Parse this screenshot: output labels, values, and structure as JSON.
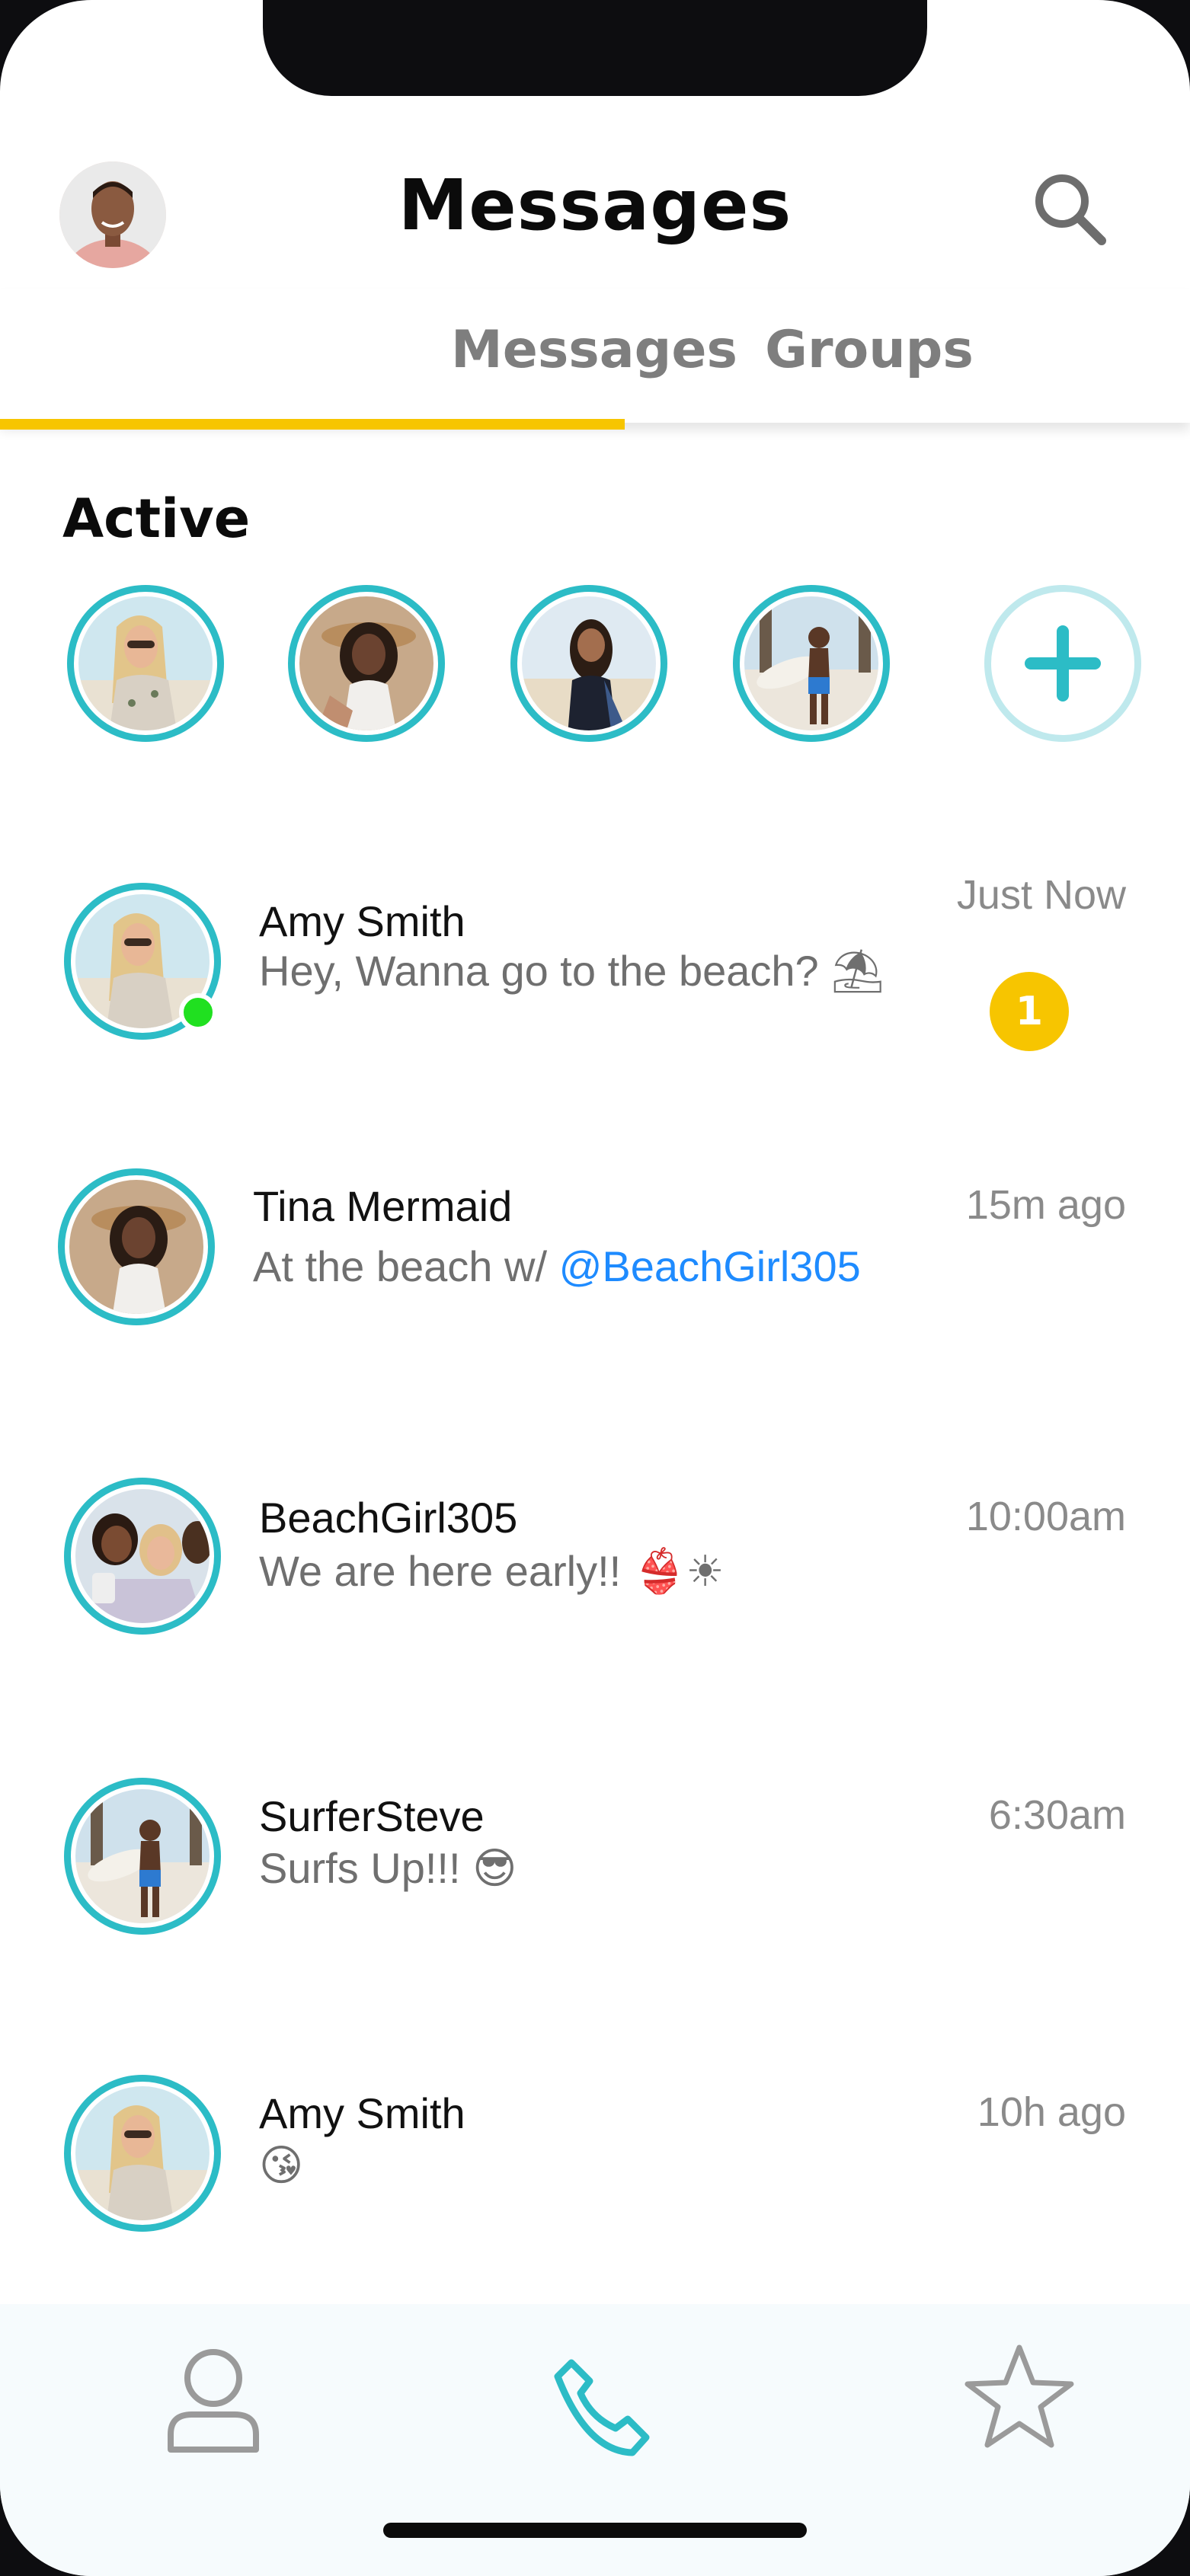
{
  "header": {
    "title": "Messages",
    "search_icon": "search-icon",
    "profile_avatar": "profile-avatar"
  },
  "tabs": [
    {
      "label": "Messages",
      "selected": true
    },
    {
      "label": "Groups",
      "selected": false
    }
  ],
  "active": {
    "label": "Active",
    "users": [
      {
        "avatar": "amy-avatar"
      },
      {
        "avatar": "tina-avatar"
      },
      {
        "avatar": "girl-avatar"
      },
      {
        "avatar": "steve-avatar"
      }
    ],
    "add_icon": "plus-icon"
  },
  "conversations": [
    {
      "name": "Amy Smith",
      "message": "Hey, Wanna go to the beach?",
      "emoji": "⛱",
      "time": "Just Now",
      "unread": "1",
      "online": true
    },
    {
      "name": "Tina Mermaid",
      "message": "At  the beach w/ ",
      "mention": "@BeachGirl305",
      "time": "15m ago"
    },
    {
      "name": "BeachGirl305",
      "message": "We are here early!!",
      "emoji": "👙☀",
      "time": "10:00am"
    },
    {
      "name": "SurferSteve",
      "message": "Surfs Up!!!",
      "emoji": "😎",
      "time": "6:30am"
    },
    {
      "name": "Amy Smith",
      "message": "",
      "emoji": "😘",
      "time": "10h ago"
    }
  ],
  "bottom_nav": [
    {
      "icon": "user-icon",
      "active": false
    },
    {
      "icon": "phone-icon",
      "active": true
    },
    {
      "icon": "star-icon",
      "active": false
    }
  ],
  "colors": {
    "accent": "#2cbcc6",
    "yellow": "#f7c500",
    "mention": "#1e8bff",
    "online": "#20e020"
  }
}
